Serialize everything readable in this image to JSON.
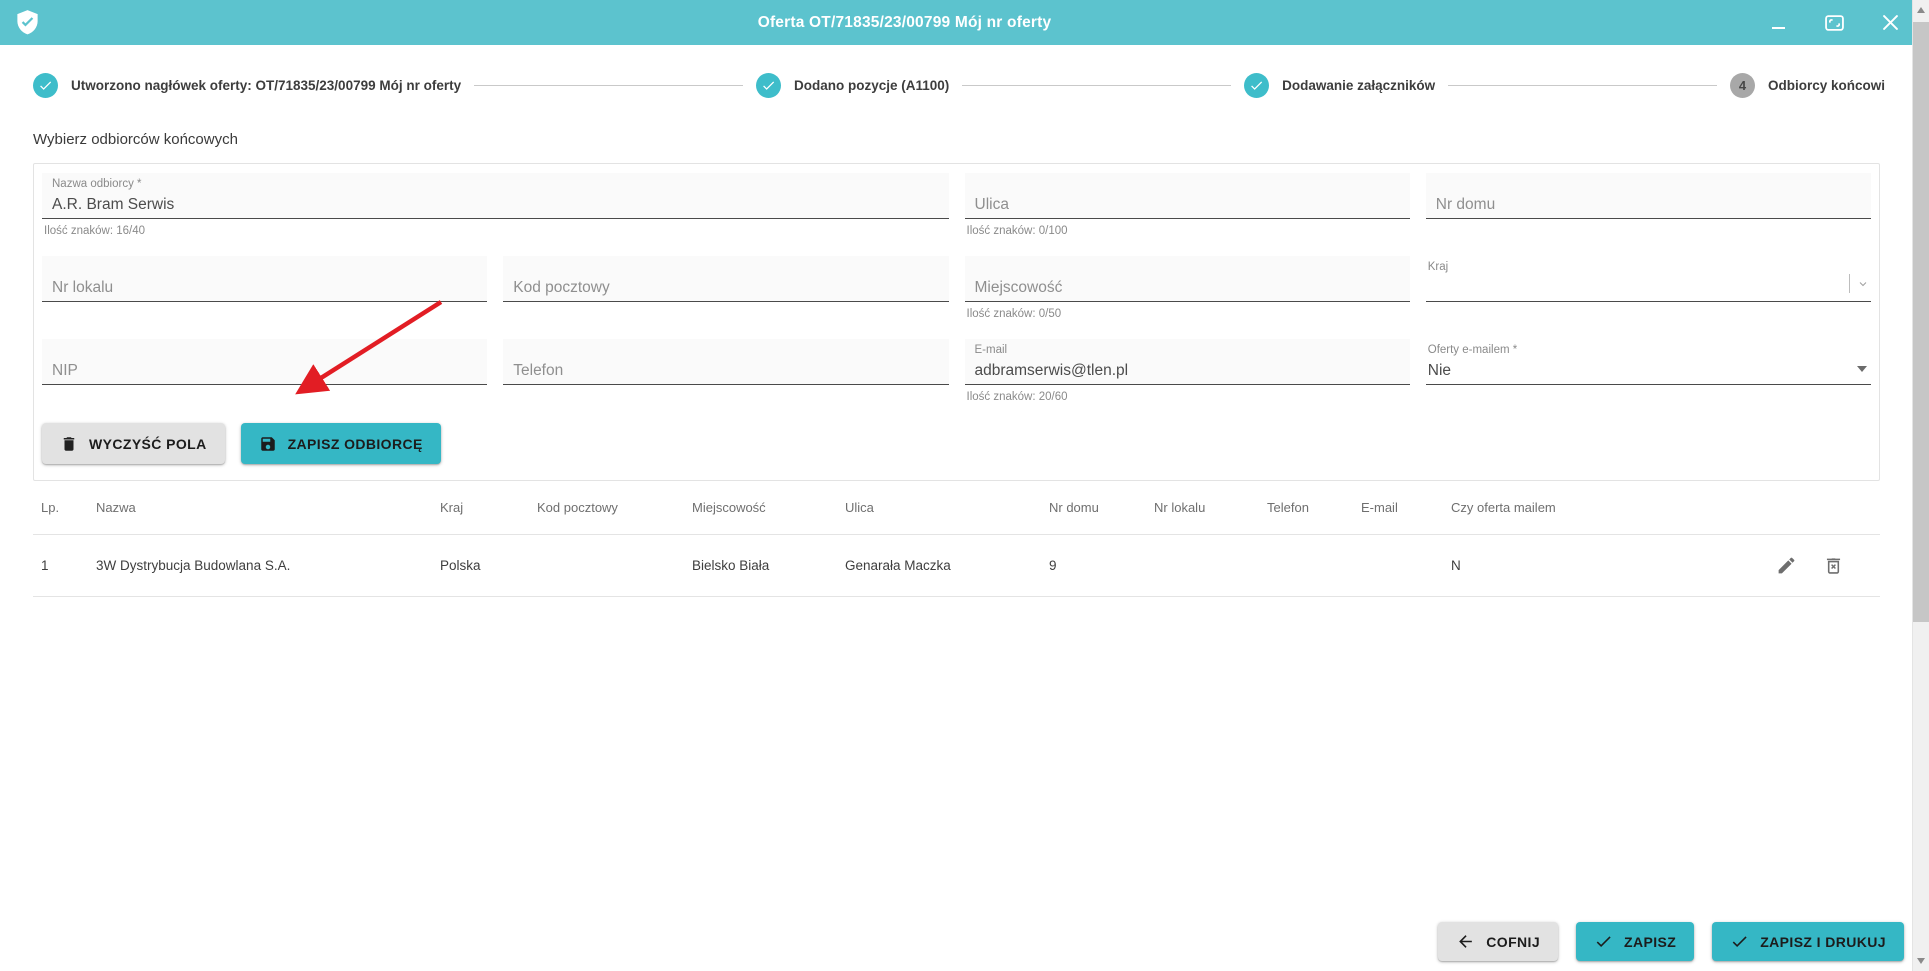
{
  "titlebar": {
    "title": "Oferta OT/71835/23/00799 Mój nr oferty"
  },
  "stepper": {
    "steps": [
      {
        "label": "Utworzono nagłówek oferty: OT/71835/23/00799 Mój nr oferty",
        "state": "done"
      },
      {
        "label": "Dodano pozycje (A1100)",
        "state": "done"
      },
      {
        "label": "Dodawanie załączników",
        "state": "done"
      },
      {
        "label": "Odbiorcy końcowi",
        "state": "pending",
        "number": "4"
      }
    ]
  },
  "section_title": "Wybierz odbiorców końcowych",
  "form": {
    "fields": {
      "nazwa": {
        "label": "Nazwa odbiorcy *",
        "value": "A.R. Bram Serwis",
        "hint": "Ilość znaków: 16/40"
      },
      "ulica": {
        "placeholder": "Ulica",
        "hint": "Ilość znaków: 0/100"
      },
      "nr_domu": {
        "placeholder": "Nr domu"
      },
      "nr_lokalu": {
        "placeholder": "Nr lokalu"
      },
      "kod_pocztowy": {
        "placeholder": "Kod pocztowy"
      },
      "miejscowosc": {
        "placeholder": "Miejscowość",
        "hint": "Ilość znaków: 0/50"
      },
      "kraj": {
        "label": "Kraj",
        "value": ""
      },
      "nip": {
        "placeholder": "NIP"
      },
      "telefon": {
        "placeholder": "Telefon"
      },
      "email": {
        "label": "E-mail",
        "value": "adbramserwis@tlen.pl",
        "hint": "Ilość znaków: 20/60"
      },
      "oferty_emailem": {
        "label": "Oferty e-mailem *",
        "value": "Nie"
      }
    },
    "buttons": {
      "clear": "WYCZYŚĆ POLA",
      "save_recipient": "ZAPISZ ODBIORCĘ"
    }
  },
  "table": {
    "columns": [
      "Lp.",
      "Nazwa",
      "Kraj",
      "Kod pocztowy",
      "Miejscowość",
      "Ulica",
      "Nr domu",
      "Nr lokalu",
      "Telefon",
      "E-mail",
      "Czy oferta mailem"
    ],
    "rows": [
      {
        "lp": "1",
        "nazwa": "3W Dystrybucja Budowlana S.A.",
        "kraj": "Polska",
        "kod_pocztowy": "",
        "miejscowosc": "Bielsko Biała",
        "ulica": "Genarała Maczka",
        "nr_domu": "9",
        "nr_lokalu": "",
        "telefon": "",
        "email": "",
        "czy_oferta_mailem": "N"
      }
    ]
  },
  "footer": {
    "back": "COFNIJ",
    "save": "ZAPISZ",
    "save_print": "ZAPISZ I DRUKUJ"
  },
  "colors": {
    "titlebar_teal": "#5cc3ce",
    "button_teal": "#35b7c5",
    "step_done_teal": "#3ebdca",
    "annotation_arrow_red": "#e21d24"
  }
}
